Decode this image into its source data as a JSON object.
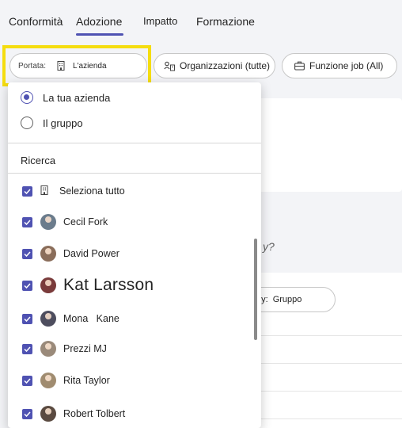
{
  "tabs": [
    {
      "label": "Conformità"
    },
    {
      "label": "Adozione"
    },
    {
      "label": "Impatto"
    },
    {
      "label": "Formazione"
    }
  ],
  "filters": {
    "scope_label": "Portata:",
    "scope_value": "L'azienda",
    "orgs_label": "Organizzazioni (tutte)",
    "job_label": "Funzione job (All)"
  },
  "background": {
    "question_fragment": "y?",
    "group_by_label": "w by:",
    "group_by_value": "Gruppo"
  },
  "dropdown": {
    "options": [
      {
        "label": "La tua azienda",
        "selected": true
      },
      {
        "label": "Il gruppo",
        "selected": false
      }
    ],
    "search_label": "Ricerca",
    "select_all_label": "Seleziona tutto",
    "people": [
      {
        "name": "Cecil Fork",
        "checked": true,
        "avatar_color": "#6b7c8c"
      },
      {
        "name": "David Power",
        "checked": true,
        "avatar_color": "#8a6d5a"
      },
      {
        "name": "Kat Larsson",
        "checked": true,
        "avatar_color": "#7a3b3b"
      },
      {
        "name": "Mona   Kane",
        "checked": true,
        "avatar_color": "#4d4d5e"
      },
      {
        "name": "Prezzi MJ",
        "checked": true,
        "avatar_color": "#9a8a7a"
      },
      {
        "name": "Rita Taylor",
        "checked": true,
        "avatar_color": "#a08c70"
      },
      {
        "name": "Robert Tolbert",
        "checked": true,
        "avatar_color": "#5a4a40"
      }
    ]
  },
  "colors": {
    "accent": "#4f52b2",
    "highlight": "#f5dd0f"
  }
}
